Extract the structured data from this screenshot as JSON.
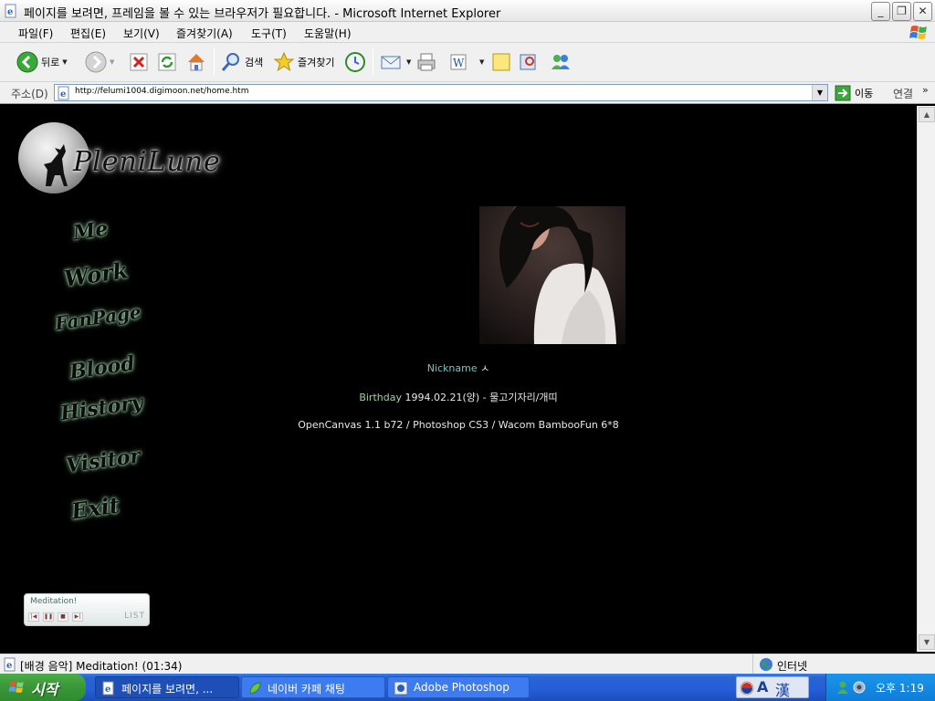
{
  "window": {
    "title": "페이지를 보려면, 프레임을 볼 수 있는 브라우저가 필요합니다. - Microsoft Internet Explorer"
  },
  "menu": [
    "파일(F)",
    "편집(E)",
    "보기(V)",
    "즐겨찾기(A)",
    "도구(T)",
    "도움말(H)"
  ],
  "toolbar": {
    "back_label": "뒤로",
    "search_label": "검색",
    "favorites_label": "즐겨찾기"
  },
  "address": {
    "label": "주소(D)",
    "url": "http://felumi1004.digimoon.net/home.htm",
    "go_label": "이동",
    "links_label": "연결"
  },
  "page": {
    "logo_text": "PleniLune",
    "nav": [
      "Me",
      "Work",
      "FanPage",
      "Blood",
      "History",
      "Visitor",
      "Exit"
    ],
    "nickname_label": "Nickname",
    "nickname_suffix": "ㅅ",
    "birthday_label": "Birthday",
    "birthday_value": "1994.02.21(양) - 물고기자리/개띠",
    "tools": "OpenCanvas 1.1 b72 / Photoshop CS3 / Wacom BambooFun 6*8",
    "player": {
      "song": "Meditation!",
      "list_label": "LIST"
    }
  },
  "status": {
    "text": "[배경 음악] Meditation! (01:34)",
    "zone": "인터넷"
  },
  "taskbar": {
    "start_label": "시작",
    "tasks": [
      "페이지를 보려면, ...",
      "네이버 카페 채팅",
      "Adobe Photoshop"
    ],
    "ime_a": "A",
    "ime_han": "漢",
    "clock": "오후 1:19"
  },
  "colors": {
    "page_bg": "#000000",
    "accent_teal": "#79c3c1",
    "nav_glow": "#7fb38c",
    "taskbar_blue": "#245dd7",
    "start_green": "#3c9a3a"
  },
  "icons": [
    "ie-page-icon",
    "minimize-icon",
    "restore-icon",
    "close-icon",
    "back-arrow-icon",
    "forward-arrow-icon",
    "stop-icon",
    "refresh-icon",
    "home-icon",
    "search-icon",
    "favorites-star-icon",
    "history-icon",
    "mail-icon",
    "print-icon",
    "edit-icon",
    "note-icon",
    "research-icon",
    "messenger-icon",
    "go-arrow-icon",
    "globe-icon",
    "windows-logo-icon"
  ]
}
